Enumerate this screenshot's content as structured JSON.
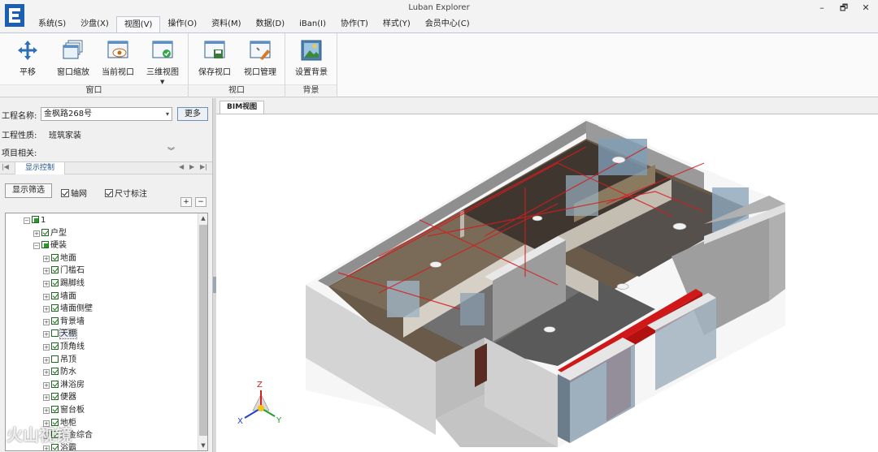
{
  "app": {
    "title": "Luban Explorer"
  },
  "window_controls": {
    "minimize": "–",
    "restore": "🗗",
    "close": "✕"
  },
  "menu": {
    "items": [
      "系统(S)",
      "沙盘(X)",
      "视图(V)",
      "操作(O)",
      "资料(M)",
      "数据(D)",
      "iBan(I)",
      "协作(T)",
      "样式(Y)",
      "会员中心(C)"
    ],
    "active": "视图(V)"
  },
  "ribbon": {
    "groups": [
      {
        "label": "窗口",
        "buttons": [
          {
            "label": "平移",
            "icon": "pan-arrows-icon"
          },
          {
            "label": "窗口缩放",
            "icon": "window-zoom-icon"
          },
          {
            "label": "当前视口",
            "icon": "current-viewport-icon"
          },
          {
            "label": "三维视图",
            "icon": "3d-view-icon"
          }
        ]
      },
      {
        "label": "视口",
        "buttons": [
          {
            "label": "保存视口",
            "icon": "save-viewport-icon"
          },
          {
            "label": "视口管理",
            "icon": "viewport-manager-icon"
          }
        ]
      },
      {
        "label": "背景",
        "buttons": [
          {
            "label": "设置背景",
            "icon": "set-background-icon"
          }
        ]
      }
    ]
  },
  "project": {
    "name_label": "工程名称:",
    "name_value": "金枫路268号",
    "more_label": "更多",
    "type_label": "工程性质:",
    "type_value": "班筑家装",
    "related_label": "项目相关:"
  },
  "panel_tab": {
    "label": "显示控制"
  },
  "display": {
    "filter_label": "显示筛选",
    "axis_label": "轴网",
    "axis_checked": true,
    "dim_label": "尺寸标注",
    "dim_checked": true,
    "plus": "+",
    "minus": "−"
  },
  "tree": {
    "rows": [
      {
        "label": "1",
        "level": 0,
        "state": "partial",
        "expander": "−"
      },
      {
        "label": "户型",
        "level": 1,
        "state": "on",
        "expander": "+"
      },
      {
        "label": "硬装",
        "level": 1,
        "state": "partial",
        "expander": "−"
      },
      {
        "label": "地面",
        "level": 2,
        "state": "on",
        "expander": "+"
      },
      {
        "label": "门槛石",
        "level": 2,
        "state": "on",
        "expander": "+"
      },
      {
        "label": "踢脚线",
        "level": 2,
        "state": "on",
        "expander": "+"
      },
      {
        "label": "墙面",
        "level": 2,
        "state": "on",
        "expander": "+"
      },
      {
        "label": "墙面侧壁",
        "level": 2,
        "state": "on",
        "expander": "+"
      },
      {
        "label": "背景墙",
        "level": 2,
        "state": "on",
        "expander": "+"
      },
      {
        "label": "天棚",
        "level": 2,
        "state": "off",
        "expander": "+",
        "selected": true
      },
      {
        "label": "顶角线",
        "level": 2,
        "state": "on",
        "expander": "+"
      },
      {
        "label": "吊顶",
        "level": 2,
        "state": "off",
        "expander": "+"
      },
      {
        "label": "防水",
        "level": 2,
        "state": "on",
        "expander": "+"
      },
      {
        "label": "淋浴房",
        "level": 2,
        "state": "on",
        "expander": "+"
      },
      {
        "label": "便器",
        "level": 2,
        "state": "on",
        "expander": "+"
      },
      {
        "label": "窗台板",
        "level": 2,
        "state": "on",
        "expander": "+"
      },
      {
        "label": "地柜",
        "level": 2,
        "state": "on",
        "expander": "+"
      },
      {
        "label": "五金综合",
        "level": 2,
        "state": "on",
        "expander": "+"
      },
      {
        "label": "浴霸",
        "level": 2,
        "state": "on",
        "expander": "+"
      }
    ]
  },
  "viewport": {
    "tab_label": "BIM视图",
    "axis_x": "X",
    "axis_y": "Y",
    "axis_z": "Z"
  },
  "watermark": "火山视镜"
}
